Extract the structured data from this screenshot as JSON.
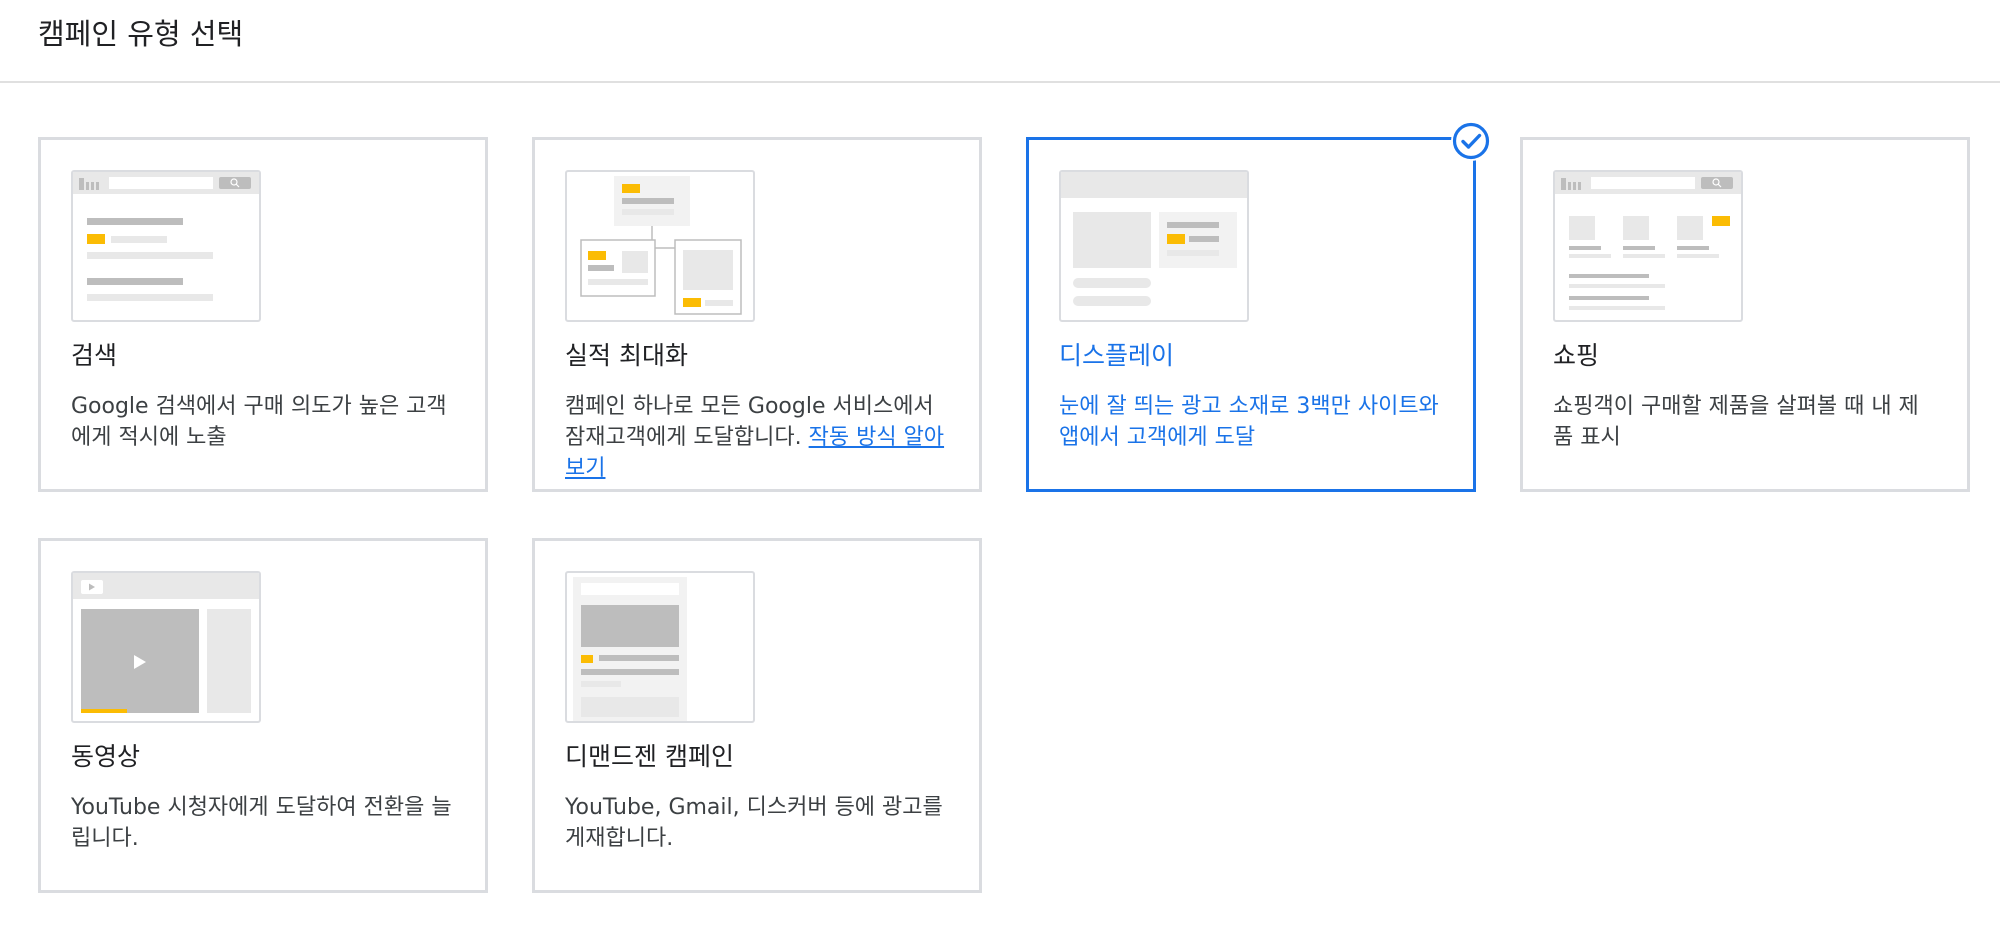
{
  "header": {
    "title": "캠페인 유형 선택"
  },
  "colors": {
    "accent": "#1a73e8",
    "border": "#dadce0",
    "placeholder_gray": "#bdbdbd",
    "placeholder_light": "#e8e8e8",
    "highlight_yellow": "#fbbc04"
  },
  "cards": [
    {
      "title": "검색",
      "desc": "Google 검색에서 구매 의도가 높은 고객에게 적시에 노출",
      "selected": false
    },
    {
      "title": "실적 최대화",
      "desc": "캠페인 하나로 모든 Google 서비스에서 잠재고객에게 도달합니다. ",
      "link": "작동 방식 알아보기",
      "selected": false
    },
    {
      "title": "디스플레이",
      "desc": "눈에 잘 띄는 광고 소재로 3백만 사이트와 앱에서 고객에게 도달",
      "selected": true
    },
    {
      "title": "쇼핑",
      "desc": "쇼핑객이 구매할 제품을 살펴볼 때 내 제품 표시",
      "selected": false
    },
    {
      "title": "동영상",
      "desc": "YouTube 시청자에게 도달하여 전환을 늘립니다.",
      "selected": false
    },
    {
      "title": "디맨드젠 캠페인",
      "desc": "YouTube, Gmail, 디스커버 등에 광고를 게재합니다.",
      "selected": false
    }
  ],
  "icons": {
    "selected_check": "check-circle-icon",
    "video_play": "play-icon"
  }
}
